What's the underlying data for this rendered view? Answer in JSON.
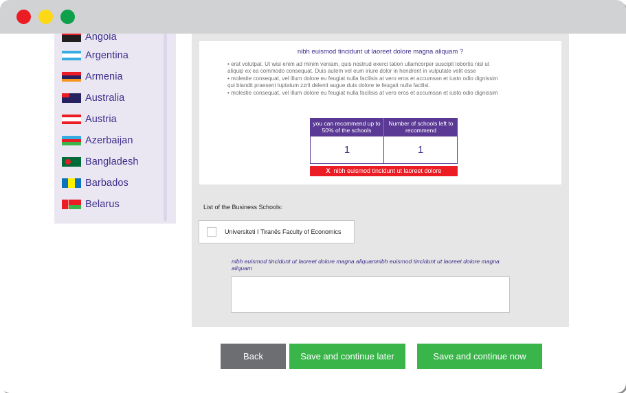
{
  "window": {
    "controls": [
      "close",
      "minimize",
      "maximize"
    ]
  },
  "sidebar": {
    "countries": [
      {
        "name": "Angola",
        "flag": "angola"
      },
      {
        "name": "Argentina",
        "flag": "argentina"
      },
      {
        "name": "Armenia",
        "flag": "armenia"
      },
      {
        "name": "Australia",
        "flag": "australia"
      },
      {
        "name": "Austria",
        "flag": "austria"
      },
      {
        "name": "Azerbaijan",
        "flag": "azerbaijan"
      },
      {
        "name": "Bangladesh",
        "flag": "bangladesh"
      },
      {
        "name": "Barbados",
        "flag": "barbados"
      },
      {
        "name": "Belarus",
        "flag": "belarus"
      }
    ]
  },
  "info": {
    "title": "nibh euismod tincidunt ut laoreet dolore magna aliquam ?",
    "lines": [
      "• erat volutpat. Ut wisi enim ad minim veniam, quis nostrud exerci tation ullamcorper suscipit lobortis nisl ut",
      "aliquip ex ea commodo consequat. Duis autem vel eum iriure dolor in hendrerit in vulputate velit esse",
      "• molestie consequat, vel illum dolore eu feugiat nulla facilisis at vero eros et accumsan et iusto odio dignissim",
      "qui blandit praesent luptatum zzril delenit augue duis dolore te feugait nulla facilisi.",
      "• molestie consequat, vel illum dolore eu feugiat nulla facilisis at vero eros et accumsan et iusto odio dignissim"
    ]
  },
  "recommend_table": {
    "headers": [
      "you can recommend up to 50% of the schools",
      "Number of schools left to recommend"
    ],
    "values": [
      "1",
      "1"
    ],
    "error_icon": "X",
    "error_text": "nibh euismod tincidunt ut laoreet dolore"
  },
  "schools": {
    "label": "List of the Business Schools:",
    "items": [
      {
        "name": "Universiteti I Tiranës Faculty of Economics",
        "checked": false
      }
    ]
  },
  "comment": {
    "label": "nibh euismod tincidunt ut laoreet dolore magna aliquamnibh euismod tincidunt ut laoreet dolore magna aliquam",
    "value": "",
    "placeholder": ""
  },
  "buttons": {
    "back": "Back",
    "save_later": "Save and continue later",
    "save_now": "Save and continue now"
  },
  "colors": {
    "accent_purple": "#5b3a95",
    "text_purple": "#3c2e8a",
    "success_green": "#3ab54a",
    "error_red": "#ec1c24",
    "neutral_gray": "#6d6e71"
  }
}
